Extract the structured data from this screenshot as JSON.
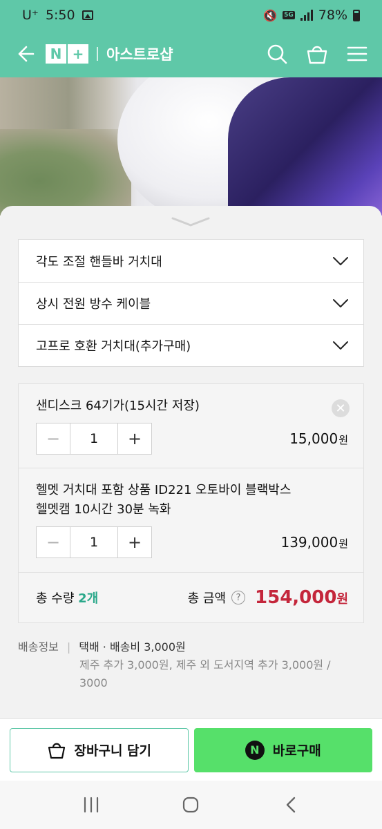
{
  "status_bar": {
    "carrier": "U⁺",
    "time": "5:50",
    "network": "5G",
    "battery": "78%"
  },
  "header": {
    "logo_n": "N",
    "logo_plus": "+",
    "store_name": "아스트로샵"
  },
  "options": [
    {
      "label": "각도 조절 핸들바 거치대"
    },
    {
      "label": "상시 전원 방수 케이블"
    },
    {
      "label": "고프로 호환 거치대(추가구매)"
    }
  ],
  "selected_items": [
    {
      "name": "샌디스크 64기가(15시간 저장)",
      "quantity": "1",
      "price": "15,000",
      "currency": "원"
    },
    {
      "name_line1": "헬멧 거치대 포함 상품 ID221 오토바이 블랙박스",
      "name_line2": "헬멧캠 10시간 30분 녹화",
      "quantity": "1",
      "price": "139,000",
      "currency": "원"
    }
  ],
  "total": {
    "qty_prefix": "총 수량 ",
    "qty_count": "2개",
    "amount_label": "총 금액",
    "help": "?",
    "amount": "154,000",
    "currency": "원"
  },
  "shipping": {
    "label": "배송정보",
    "main": "택배 · 배송비 3,000원",
    "detail_line1": "제주 추가 3,000원, 제주 외 도서지역 추가 3,000원 /",
    "detail_line2": "3000"
  },
  "buttons": {
    "cart": "장바구니 담기",
    "buy": "바로구매",
    "buy_badge": "N"
  },
  "colors": {
    "brand": "#5fc8a8",
    "buy": "#56e06a",
    "price_total": "#c4263b"
  }
}
